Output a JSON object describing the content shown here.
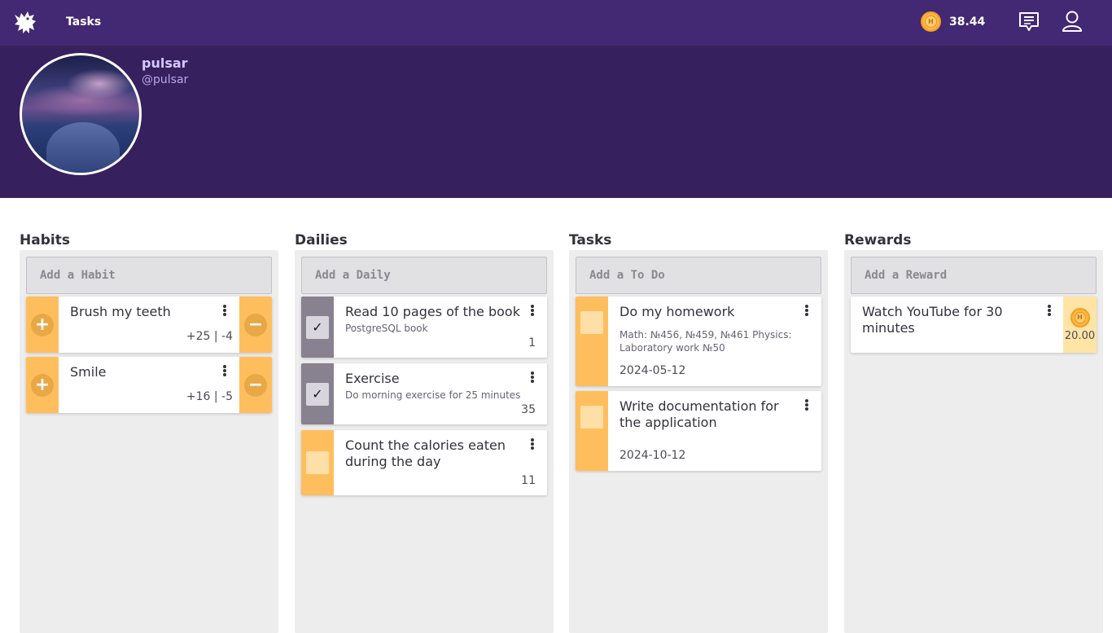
{
  "nav": {
    "app_title": "Tasks",
    "gold": "38.44",
    "coin_letter": "H",
    "icons": [
      "logo-icon",
      "coin-icon",
      "messages-icon",
      "user-icon"
    ]
  },
  "profile": {
    "name": "pulsar",
    "handle": "@pulsar"
  },
  "habits": {
    "title": "Habits",
    "add_placeholder": "Add a Habit",
    "items": [
      {
        "text": "Brush my teeth",
        "score": "+25 | -4"
      },
      {
        "text": "Smile",
        "score": "+16 | -5"
      }
    ]
  },
  "dailies": {
    "title": "Dailies",
    "add_placeholder": "Add a Daily",
    "items": [
      {
        "text": "Read 10 pages of the book",
        "notes": "PostgreSQL book",
        "streak": "1",
        "completed": true
      },
      {
        "text": "Exercise",
        "notes": "Do morning exercise for 25 minutes",
        "streak": "35",
        "completed": true
      },
      {
        "text": "Count the calories eaten during the day",
        "notes": "",
        "streak": "11",
        "completed": false
      }
    ]
  },
  "todos": {
    "title": "Tasks",
    "add_placeholder": "Add a To Do",
    "items": [
      {
        "text": "Do my homework",
        "notes": "Math: №456, №459, №461 Physics: Laboratory work №50",
        "due": "2024-05-12"
      },
      {
        "text": "Write documentation for the application",
        "notes": "",
        "due": "2024-10-12"
      }
    ]
  },
  "rewards": {
    "title": "Rewards",
    "add_placeholder": "Add a Reward",
    "items": [
      {
        "text": "Watch YouTube for 30 minutes",
        "price": "20.00"
      }
    ]
  },
  "colors": {
    "topbar": "#432874",
    "header": "#36205d",
    "habit_control": "#ffbe5d",
    "completed_daily": "#878190",
    "reward_price_bg": "#ffe4a6"
  }
}
